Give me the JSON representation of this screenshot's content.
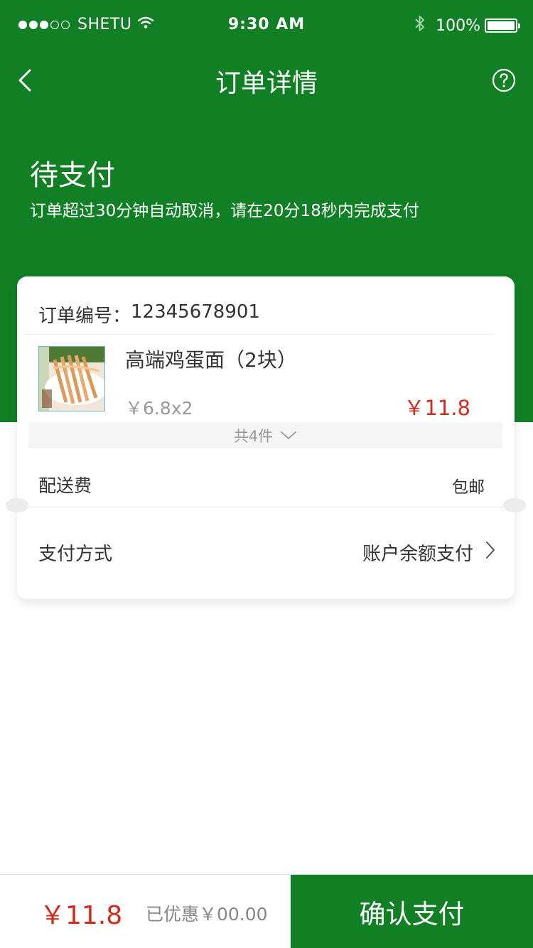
{
  "status_bar": {
    "carrier": "SHETU",
    "time": "9:30 AM",
    "battery": "100%",
    "signal_icon": "signal-dots-icon",
    "wifi_icon": "wifi-icon",
    "bluetooth_icon": "bluetooth-icon",
    "battery_icon": "battery-icon"
  },
  "nav": {
    "title": "订单详情",
    "back_icon": "chevron-left-icon",
    "help_icon": "question-circle-icon"
  },
  "order_status": {
    "title": "待支付",
    "description": "订单超过30分钟自动取消，请在20分18秒内完成支付"
  },
  "order": {
    "number_label": "订单编号：",
    "number": "12345678901",
    "product": {
      "name": "高端鸡蛋面（2块）",
      "unit_price": "￥6.8x2",
      "total": "￥11.8",
      "image_icon": "noodle-product-image"
    },
    "item_count": "共4件",
    "expand_icon": "chevron-down-icon",
    "shipping_label": "配送费",
    "shipping_value": "包邮",
    "payment_label": "支付方式",
    "payment_value": "账户余额支付",
    "payment_arrow_icon": "chevron-right-icon"
  },
  "footer": {
    "total": "￥11.8",
    "discount": "已优惠￥00.00",
    "confirm": "确认支付"
  },
  "colors": {
    "brand_green": "#118025",
    "price_red": "#d42a1d"
  }
}
